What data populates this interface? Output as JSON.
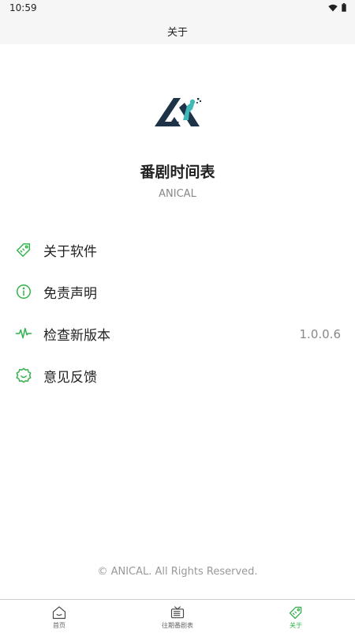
{
  "status_bar": {
    "time": "10:59",
    "icons": [
      "wifi-icon",
      "battery-icon"
    ]
  },
  "app_bar": {
    "title": "关于"
  },
  "about": {
    "logo_icon": "anical-logo",
    "app_name": "番剧时间表",
    "app_subtitle": "ANICAL"
  },
  "menu": {
    "items": [
      {
        "label": "关于软件",
        "icon": "tag-icon"
      },
      {
        "label": "免责声明",
        "icon": "info-icon"
      },
      {
        "label": "检查新版本",
        "icon": "pulse-icon",
        "value": "1.0.0.6"
      },
      {
        "label": "意见反馈",
        "icon": "feedback-icon"
      }
    ]
  },
  "footer": {
    "copyright": "© ANICAL. All Rights Reserved."
  },
  "bottom_nav": {
    "items": [
      {
        "label": "首页",
        "icon": "home-icon",
        "active": false
      },
      {
        "label": "往期番剧表",
        "icon": "tv-icon",
        "active": false
      },
      {
        "label": "关于",
        "icon": "tag-icon",
        "active": true
      }
    ]
  },
  "colors": {
    "accent": "#2fb24a",
    "logo_dark": "#1f3348",
    "logo_teal": "#3fb8b8"
  }
}
